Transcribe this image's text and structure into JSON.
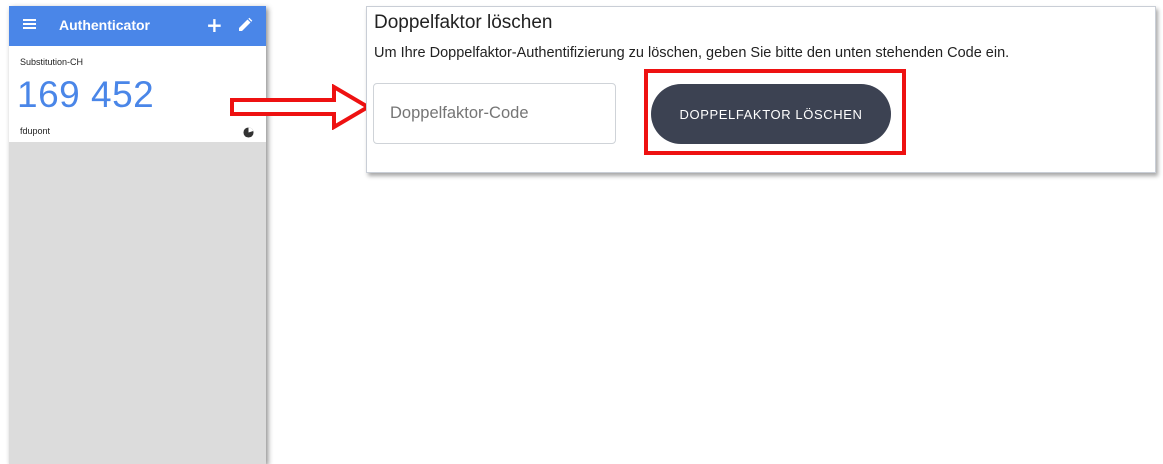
{
  "authenticator": {
    "title": "Authenticator",
    "add_icon": "+",
    "entry": {
      "issuer": "Substitution-CH",
      "code": "169 452",
      "account": "fdupont"
    }
  },
  "dialog": {
    "heading": "Doppelfaktor löschen",
    "description": "Um Ihre Doppelfaktor-Authentifizierung zu löschen, geben Sie bitte den unten stehenden Code ein.",
    "code_placeholder": "Doppelfaktor-Code",
    "code_value": "",
    "delete_label": "DOPPELFAKTOR LÖSCHEN"
  },
  "colors": {
    "appbar": "#4a86e8",
    "code": "#4a86e8",
    "button": "#3c4252",
    "highlight": "#ee1111"
  },
  "icons": {
    "menu": "menu-icon",
    "add": "plus-icon",
    "edit": "pencil-icon",
    "timer": "timer-icon",
    "arrow": "right-arrow"
  }
}
